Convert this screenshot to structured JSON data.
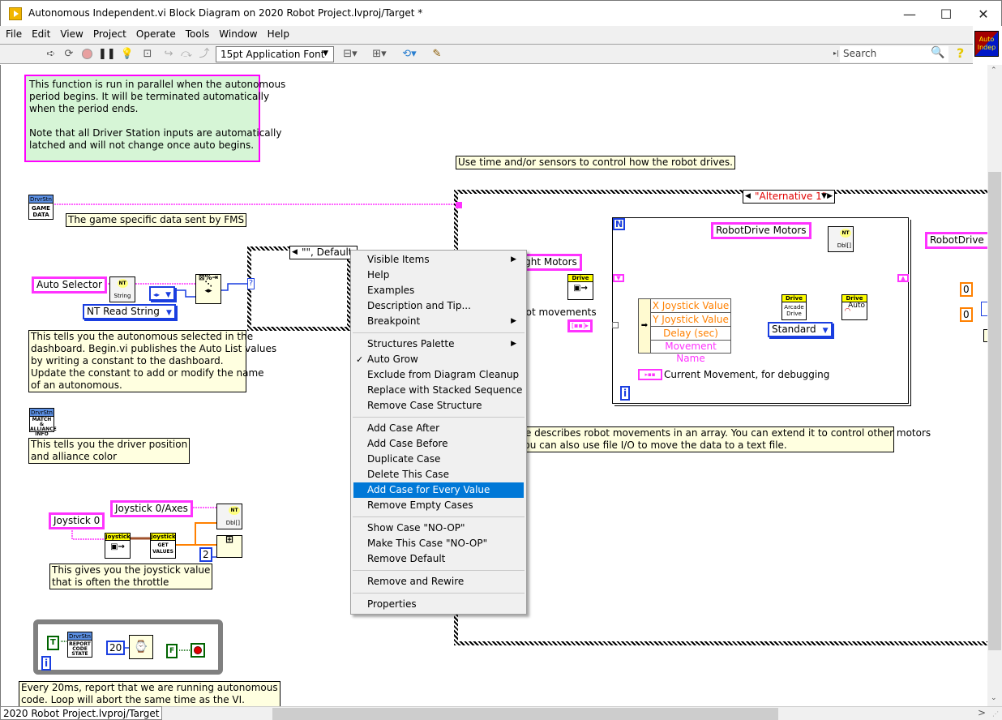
{
  "window": {
    "title": "Autonomous Independent.vi Block Diagram on 2020 Robot Project.lvproj/Target *",
    "minimize": "—",
    "maximize": "☐",
    "close": "✕"
  },
  "menubar": [
    "File",
    "Edit",
    "View",
    "Project",
    "Operate",
    "Tools",
    "Window",
    "Help"
  ],
  "toolbar": {
    "font_select": "15pt Application Font",
    "search_placeholder": "Search",
    "vi_icon_line1": "Auto",
    "vi_icon_line2": "Indep",
    "icons": [
      "run-arrow-icon",
      "run-continuous-icon",
      "abort-icon",
      "pause-icon",
      "highlight-execution-icon",
      "retain-wire-values-icon",
      "step-into-icon",
      "step-over-icon",
      "step-out-icon",
      "align-objects-icon",
      "distribute-objects-icon",
      "reorder-icon",
      "cleanup-diagram-icon"
    ]
  },
  "diagram": {
    "notes": {
      "intro_line1": "This function is run in parallel when the autonomous",
      "intro_line2": "period begins. It will be terminated automatically",
      "intro_line3": "when the period ends.",
      "intro_line4": "Note that all Driver Station inputs are automatically",
      "intro_line5": "latched and will not change once auto begins.",
      "game_data": "The game specific data sent by FMS",
      "auto_selector_1": "This tells you the autonomous selected in the",
      "auto_selector_2": "dashboard. Begin.vi publishes the Auto List values",
      "auto_selector_3": "by writing a constant to the dashboard.",
      "auto_selector_4": "Update the constant to add or modify the name",
      "auto_selector_5": "of an autonomous.",
      "driver_pos_1": "This tells you the driver position",
      "driver_pos_2": "and alliance color",
      "joystick_1": "This gives you the joystick value",
      "joystick_2": "that is often the throttle",
      "loop_1": "Every 20ms, report that we are running autonomous",
      "loop_2": "code. Loop will abort the same time as the VI.",
      "drive_control": "Use time and/or sensors to control how the robot drives.",
      "array_desc_1": "ode describes robot movements in an array. You can extend it to control other motors",
      "array_desc_2": ". You can also use file I/O to move the data to a text file."
    },
    "labels": {
      "auto_selector": "Auto Selector",
      "joystick0": "Joystick 0",
      "joystick0_axes": "Joystick 0/Axes",
      "robotdrive_motors": "RobotDrive Motors",
      "robotdrive_m_right": "RobotDrive M",
      "right_motors": "d Right Motors",
      "robot_movements": "bot movements",
      "current_movement": "Current Movement, for debugging"
    },
    "nodes": {
      "drvrstn": "DrvrStn",
      "game_data": "GAME DATA",
      "match_info": "MATCH & ALLIANCE INFO",
      "report_code": "REPORT CODE STATE",
      "nt": "NT",
      "string": "String",
      "dbl_arr": "Dbl[]",
      "drive": "Drive",
      "arcade_drive": "Arcade Drive",
      "auto": "Auto",
      "joystick": "Joystick",
      "get_values": "GET VALUES"
    },
    "rings": {
      "nt_read_string": "NT Read String",
      "standard": "Standard"
    },
    "constants": {
      "array_index": "2",
      "wait_ms": "20",
      "true_const": "T",
      "false_const": "F",
      "zero_a": "0",
      "zero_b": "0"
    },
    "case_selectors": {
      "left_case": "\"\", Default",
      "right_case": "\"Alternative 1\""
    },
    "cluster_fields": [
      "X Joystick Value",
      "Y Joystick Value",
      "Delay (sec)",
      "Movement Name"
    ],
    "loop_terminals": {
      "for_count": "N",
      "iteration": "i"
    }
  },
  "context_menu": {
    "groups": [
      [
        {
          "label": "Visible Items",
          "submenu": true
        },
        {
          "label": "Help"
        },
        {
          "label": "Examples"
        },
        {
          "label": "Description and Tip..."
        },
        {
          "label": "Breakpoint",
          "submenu": true
        }
      ],
      [
        {
          "label": "Structures Palette",
          "submenu": true
        },
        {
          "label": "Auto Grow",
          "checked": true
        },
        {
          "label": "Exclude from Diagram Cleanup"
        },
        {
          "label": "Replace with Stacked Sequence"
        },
        {
          "label": "Remove Case Structure"
        }
      ],
      [
        {
          "label": "Add Case After"
        },
        {
          "label": "Add Case Before"
        },
        {
          "label": "Duplicate Case"
        },
        {
          "label": "Delete This Case"
        },
        {
          "label": "Add Case for Every Value",
          "highlighted": true
        },
        {
          "label": "Remove Empty Cases"
        }
      ],
      [
        {
          "label": "Show Case \"NO-OP\""
        },
        {
          "label": "Make This Case \"NO-OP\""
        },
        {
          "label": "Remove Default"
        }
      ],
      [
        {
          "label": "Remove and Rewire"
        }
      ],
      [
        {
          "label": "Properties"
        }
      ]
    ]
  },
  "status": {
    "path": "2020 Robot Project.lvproj/Target",
    "scroll_left": "<",
    "scroll_right": ">"
  },
  "colors": {
    "string_wire": "#ff33ff",
    "numeric_wire": "#ff8000",
    "enum_wire": "#1a3ee0",
    "menu_highlight": "#0078d7",
    "comment_bg": "#ffffe0",
    "intro_bg": "#d6f5d6"
  }
}
